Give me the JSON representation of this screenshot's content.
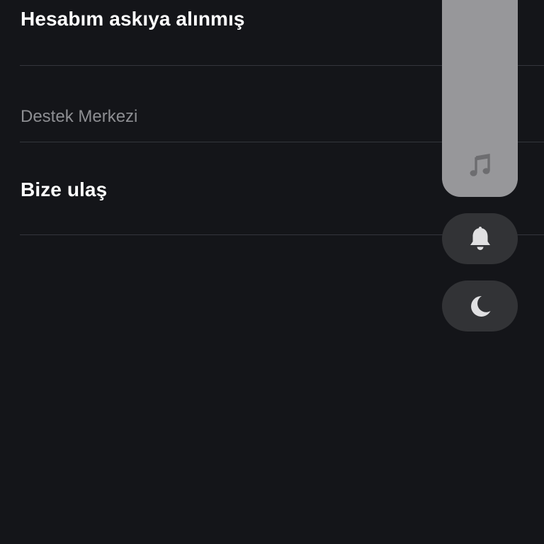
{
  "menu": {
    "account_suspended": "Hesabım askıya alınmış",
    "support_center_header": "Destek Merkezi",
    "contact_us": "Bize ulaş"
  },
  "controls": {
    "volume": {
      "icon": "music-note-icon",
      "level": 1.0
    },
    "buttons": [
      {
        "icon": "bell-icon"
      },
      {
        "icon": "moon-icon"
      }
    ]
  },
  "colors": {
    "background": "#141519",
    "divider": "#34363c",
    "muted_text": "#8d8e92",
    "slider_fill": "#97979a",
    "pill_background": "#323336",
    "icon_color": "#e0e0e2"
  }
}
